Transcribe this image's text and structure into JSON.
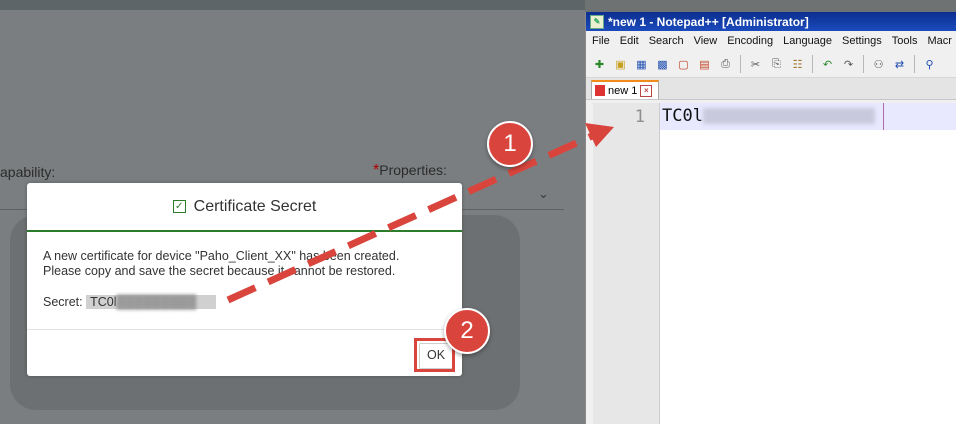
{
  "background_form": {
    "capability_label": "apability:",
    "properties_required_mark": "*",
    "properties_label": "Properties:"
  },
  "dialog": {
    "title": "Certificate Secret",
    "message_line1": "A new certificate for device \"Paho_Client_XX\" has been created.",
    "message_line2": "Please copy and save the secret because it cannot be restored.",
    "secret_label": "Secret:",
    "secret_value_visible": "TC0l",
    "ok_label": "OK"
  },
  "notepad": {
    "title": "*new 1 - Notepad++ [Administrator]",
    "menu": [
      "File",
      "Edit",
      "Search",
      "View",
      "Encoding",
      "Language",
      "Settings",
      "Tools",
      "Macr"
    ],
    "tab_label": "new 1",
    "line_number": "1",
    "line_text_visible": "TC0l"
  },
  "annotations": {
    "step1": "1",
    "step2": "2",
    "color": "#d9453d"
  },
  "colors": {
    "accent_green": "#2b7d2b",
    "npp_titlebar": "#1a4bbd",
    "tab_accent": "#f28a1c"
  }
}
